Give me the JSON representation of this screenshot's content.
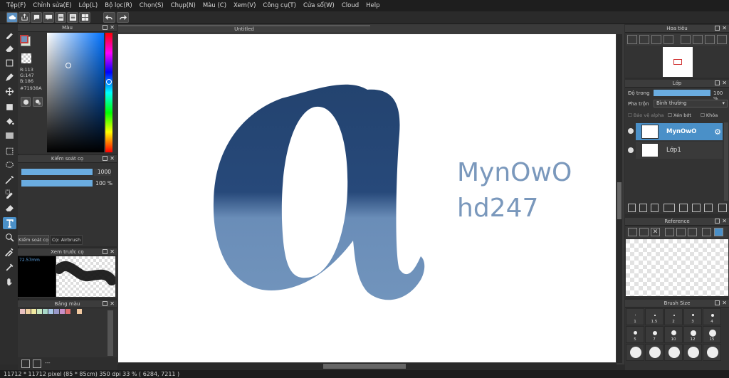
{
  "menu": [
    "Tệp(F)",
    "Chỉnh sửa(E)",
    "Lớp(L)",
    "Bộ lọc(R)",
    "Chọn(S)",
    "Chụp(N)",
    "Màu (C)",
    "Xem(V)",
    "Công cụ(T)",
    "Cửa sổ(W)",
    "Cloud",
    "Help"
  ],
  "color_panel": {
    "title": "Màu",
    "r": "R:113",
    "g": "G:147",
    "b": "B:186",
    "hex": "#71938A",
    "fg": "#7193ba",
    "bg": "#d8e8d8"
  },
  "brush_ctrl": {
    "title": "Kiểm soát cọ",
    "size": "1000",
    "opacity": "100 %",
    "tab1": "Kiểm soát cọ",
    "tab2": "Cọ: Airbrush"
  },
  "preview": {
    "title": "Xem trước cọ",
    "size": "72.57mm"
  },
  "palette": {
    "title": "Bảng màu",
    "colors": [
      "#e8c0c0",
      "#f0d0a0",
      "#f0e8a0",
      "#c8e8c0",
      "#a8d8c8",
      "#a8c8e8",
      "#9898c8",
      "#c890c8",
      "#e07070",
      "#f0c8a0"
    ],
    "extra": "---"
  },
  "doc": {
    "tab": "Untitled",
    "letter": "a",
    "text1": "MynOwO",
    "text2": "hd247",
    "letter_top": "#23436f",
    "letter_bottom": "#7194bc",
    "text_color": "#7a98bc"
  },
  "navigator": {
    "title": "Hoa tiêu"
  },
  "layers": {
    "title": "Lớp",
    "opacity_label": "Độ trong",
    "opacity_value": "100 %",
    "blend_label": "Pha trộn",
    "blend_value": "Bình thường",
    "protect_alpha": "Bảo vệ alpha",
    "clipping": "Xén bớt",
    "lock": "Khóa",
    "items": [
      {
        "name": "MynOwO",
        "selected": true
      },
      {
        "name": "Lớp1",
        "selected": false
      }
    ]
  },
  "reference": {
    "title": "Reference"
  },
  "brush_size": {
    "title": "Brush Size",
    "sizes": [
      "1",
      "1.5",
      "2",
      "3",
      "4",
      "5",
      "7",
      "10",
      "12",
      "15",
      "20",
      "",
      "",
      "",
      "",
      ""
    ]
  },
  "status": "11712 * 11712 pixel  (85 * 85cm)  350 dpi  33 %  ( 6284, 7211 )"
}
